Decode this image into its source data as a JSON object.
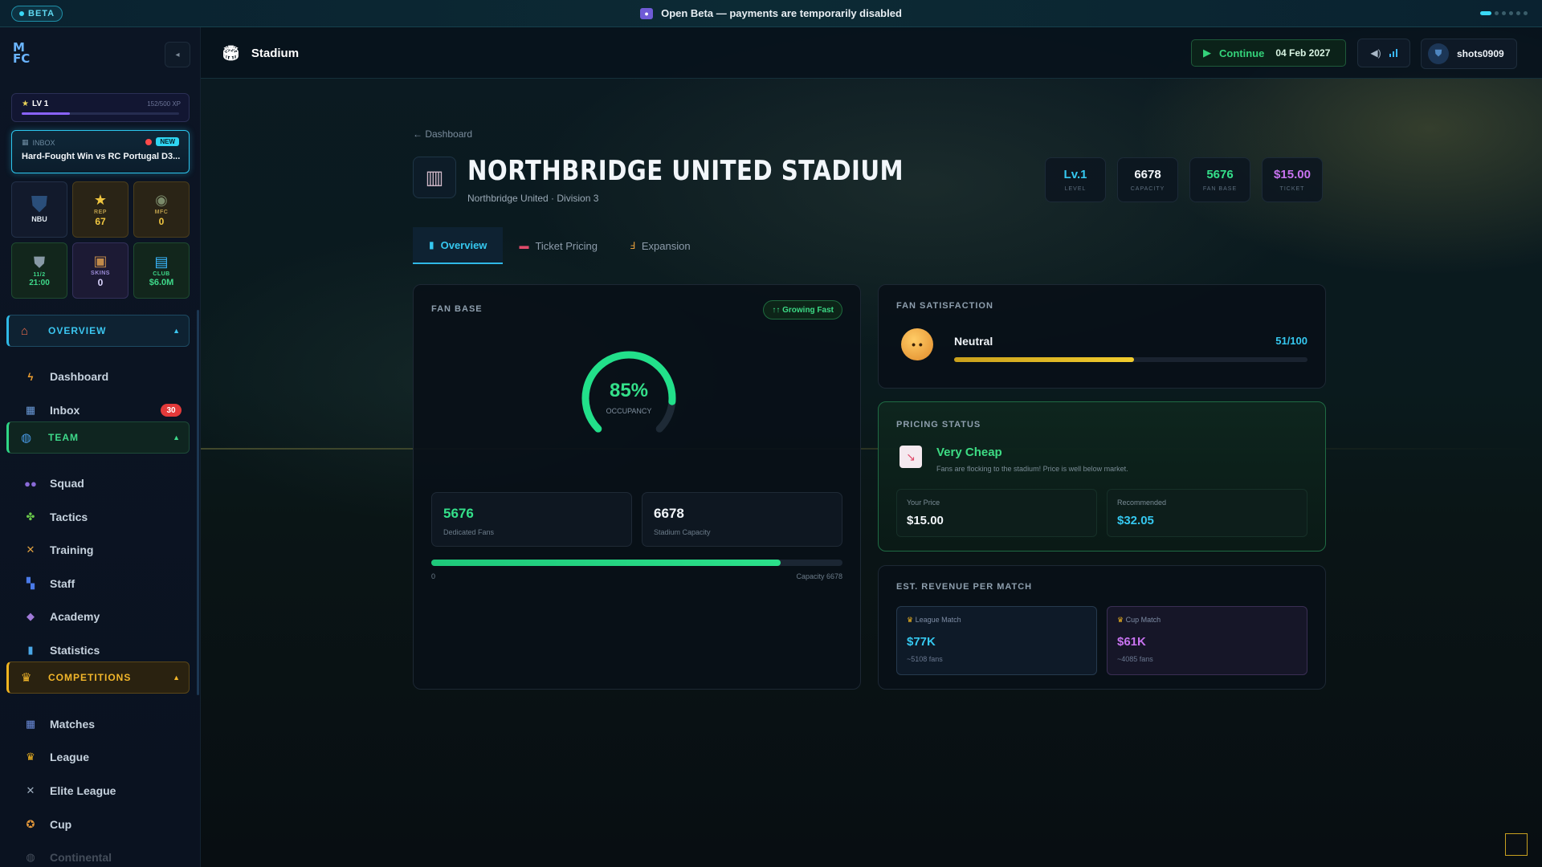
{
  "banner": {
    "beta": "BETA",
    "text": "Open Beta — payments are temporarily disabled"
  },
  "sidebar": {
    "logo": "M FC",
    "level": {
      "label": "LV 1",
      "xp": "152/500 XP",
      "progress": 0.304
    },
    "inbox_card": {
      "label": "INBOX",
      "new": "NEW",
      "text": "Hard-Fought Win vs RC Portugal D3..."
    },
    "tiles": [
      {
        "label": "",
        "value": "NBU"
      },
      {
        "label": "REP",
        "value": "67"
      },
      {
        "label": "MFC",
        "value": "0"
      },
      {
        "label": "11/2",
        "value": "21:00"
      },
      {
        "label": "SKINS",
        "value": "0"
      },
      {
        "label": "CLUB",
        "value": "$6.0M"
      }
    ],
    "sections": {
      "overview": "OVERVIEW",
      "team": "TEAM",
      "competitions": "COMPETITIONS"
    },
    "items": {
      "dashboard": "Dashboard",
      "inbox": "Inbox",
      "inbox_badge": "30",
      "squad": "Squad",
      "tactics": "Tactics",
      "training": "Training",
      "staff": "Staff",
      "academy": "Academy",
      "statistics": "Statistics",
      "matches": "Matches",
      "league": "League",
      "elite_league": "Elite League",
      "cup": "Cup",
      "continental": "Continental"
    }
  },
  "header": {
    "title": "Stadium",
    "continue": "Continue",
    "date": "04 Feb 2027",
    "username": "shots0909"
  },
  "page": {
    "back": "← Dashboard",
    "name": "NORTHBRIDGE UNITED STADIUM",
    "subtitle": "Northbridge United · Division 3",
    "stats": [
      {
        "value": "Lv.1",
        "label": "LEVEL",
        "color": "#35c8f0"
      },
      {
        "value": "6678",
        "label": "CAPACITY",
        "color": "#f2f6fa"
      },
      {
        "value": "5676",
        "label": "FAN BASE",
        "color": "#34e08a"
      },
      {
        "value": "$15.00",
        "label": "TICKET",
        "color": "#c873f0"
      }
    ],
    "tabs": [
      "Overview",
      "Ticket Pricing",
      "Expansion"
    ]
  },
  "fan_base": {
    "title": "FAN BASE",
    "badge": "↑↑ Growing Fast",
    "occupancy": "85%",
    "occupancy_value": 0.85,
    "occupancy_label": "OCCUPANCY",
    "dedicated_value": "5676",
    "dedicated_label": "Dedicated Fans",
    "capacity_value": "6678",
    "capacity_label": "Stadium Capacity",
    "bar_min": "0",
    "bar_max": "Capacity 6678",
    "fill": 0.85
  },
  "satisfaction": {
    "title": "FAN SATISFACTION",
    "label": "Neutral",
    "score": "51/100",
    "fill": 0.51
  },
  "pricing": {
    "title": "PRICING STATUS",
    "status": "Very Cheap",
    "desc": "Fans are flocking to the stadium! Price is well below market.",
    "your_label": "Your Price",
    "your_value": "$15.00",
    "rec_label": "Recommended",
    "rec_value": "$32.05"
  },
  "revenue": {
    "title": "EST. REVENUE PER MATCH",
    "league_label": "League Match",
    "league_value": "$77K",
    "league_fans": "~5108 fans",
    "cup_label": "Cup Match",
    "cup_value": "$61K",
    "cup_fans": "~4085 fans"
  }
}
